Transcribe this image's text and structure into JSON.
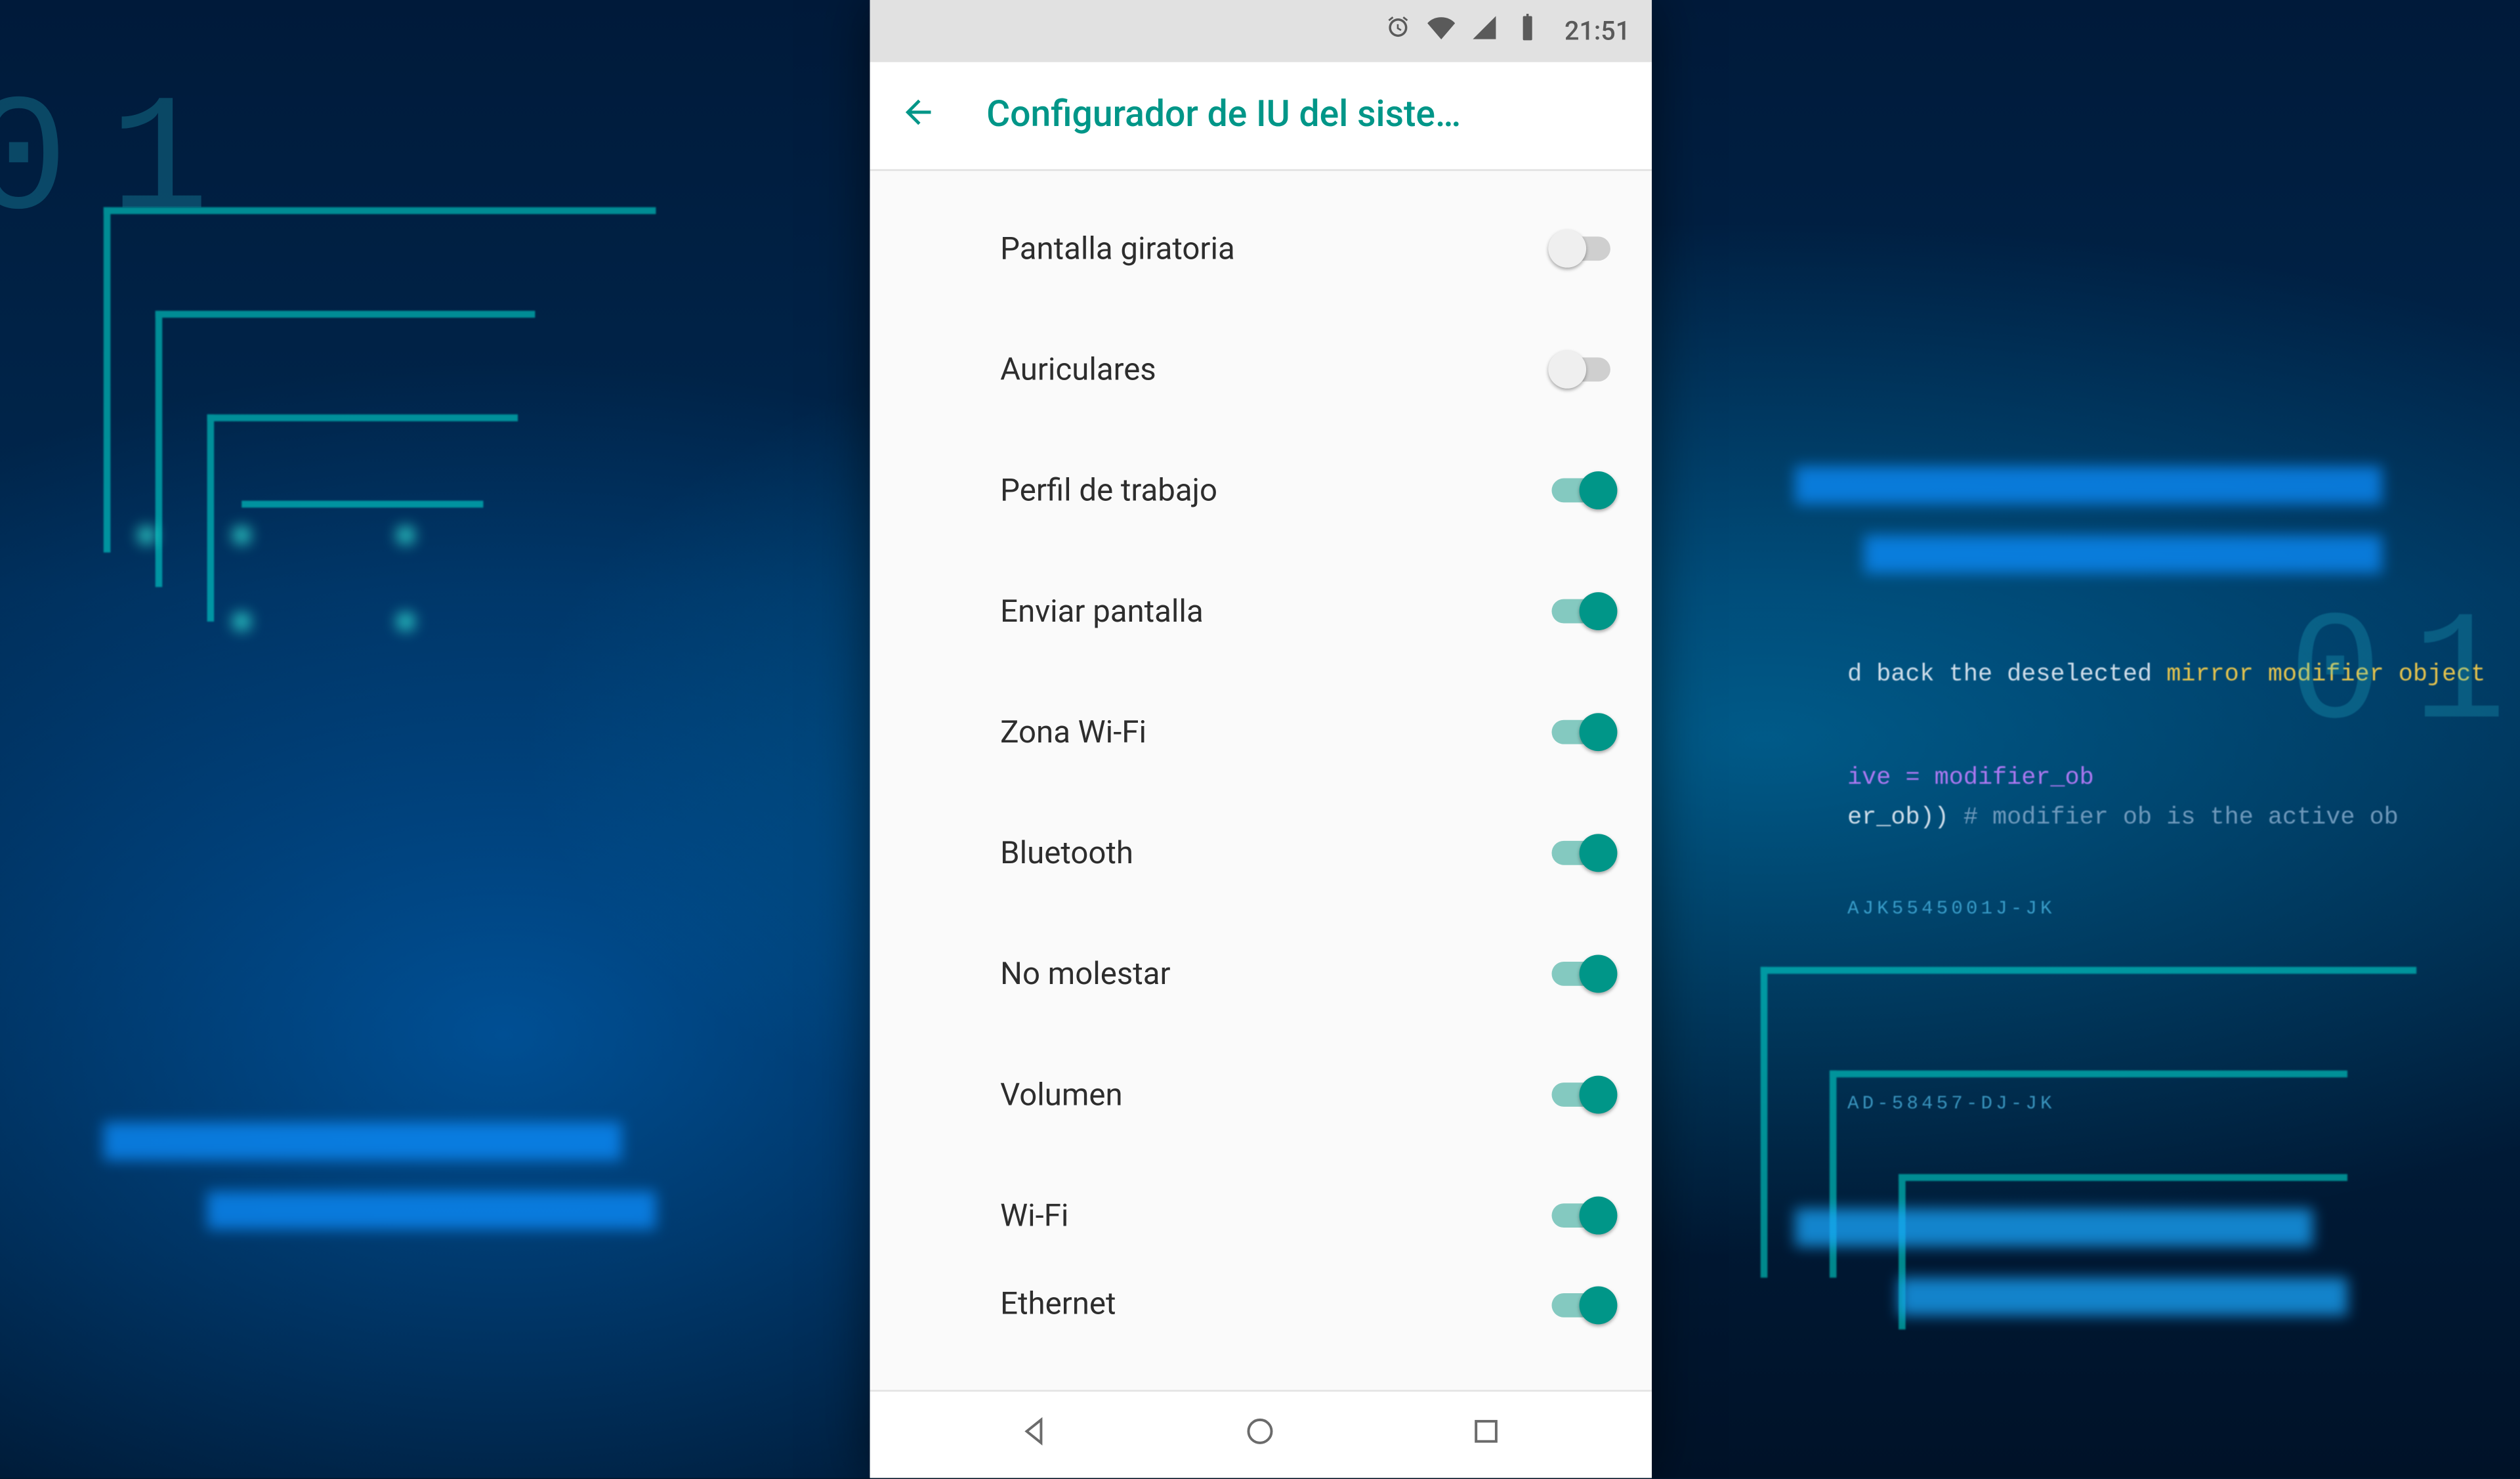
{
  "statusbar": {
    "time": "21:51"
  },
  "appbar": {
    "title": "Configurador de IU del siste…"
  },
  "settings": [
    {
      "id": "rotating-screen",
      "label": "Pantalla giratoria",
      "on": false
    },
    {
      "id": "headphones",
      "label": "Auriculares",
      "on": false
    },
    {
      "id": "work-profile",
      "label": "Perfil de trabajo",
      "on": true
    },
    {
      "id": "cast-screen",
      "label": "Enviar pantalla",
      "on": true
    },
    {
      "id": "wifi-zone",
      "label": "Zona Wi-Fi",
      "on": true
    },
    {
      "id": "bluetooth",
      "label": "Bluetooth",
      "on": true
    },
    {
      "id": "dnd",
      "label": "No molestar",
      "on": true
    },
    {
      "id": "volume",
      "label": "Volumen",
      "on": true
    },
    {
      "id": "wifi",
      "label": "Wi-Fi",
      "on": true
    },
    {
      "id": "ethernet",
      "label": "Ethernet",
      "on": true
    }
  ],
  "bg_code": {
    "line1_a": "d back the deselected ",
    "line1_b": "mirror modifier object",
    "line2": "ive = modifier_ob",
    "line3_a": "er_ob)) ",
    "line3_b": "# modifier ob is the active ob",
    "tag1": "AJK5545001J-JK",
    "tag2": "AD-58457-DJ-JK"
  },
  "colors": {
    "accent": "#009688",
    "accent_track": "#84c9c0",
    "status_bg": "#e1e1e1",
    "page_bg": "#fafafa"
  }
}
